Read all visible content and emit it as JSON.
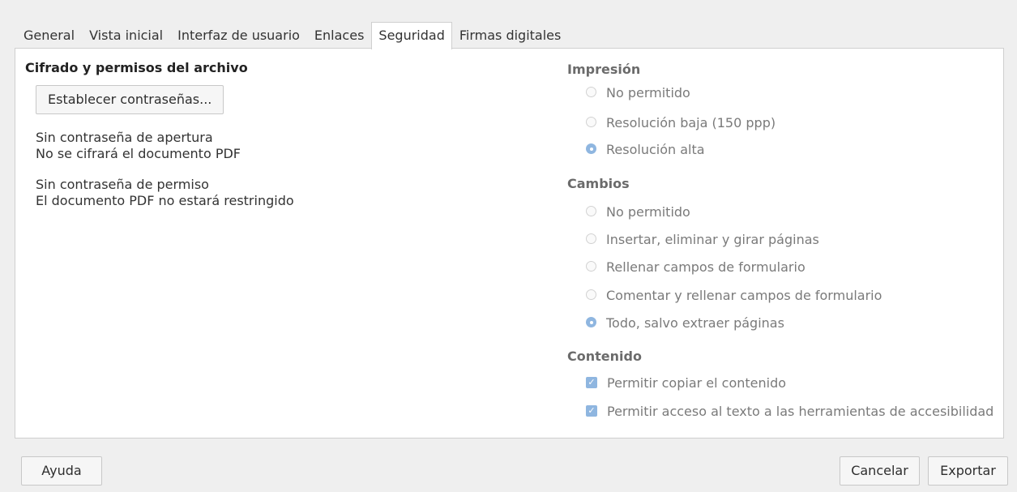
{
  "tabs": [
    {
      "label": "General",
      "active": false
    },
    {
      "label": "Vista inicial",
      "active": false
    },
    {
      "label": "Interfaz de usuario",
      "active": false
    },
    {
      "label": "Enlaces",
      "active": false
    },
    {
      "label": "Seguridad",
      "active": true
    },
    {
      "label": "Firmas digitales",
      "active": false
    }
  ],
  "left": {
    "title": "Cifrado y permisos del archivo",
    "set_passwords_button": "Establecer contraseñas...",
    "open_password_status": "Sin contraseña de apertura",
    "encryption_status": "No se cifrará el documento PDF",
    "permission_password_status": "Sin contraseña de permiso",
    "restriction_status": "El documento PDF no estará restringido"
  },
  "printing": {
    "title": "Impresión",
    "options": [
      {
        "label": "No permitido",
        "checked": false
      },
      {
        "label": "Resolución baja (150 ppp)",
        "checked": false
      },
      {
        "label": "Resolución alta",
        "checked": true
      }
    ]
  },
  "changes": {
    "title": "Cambios",
    "options": [
      {
        "label": "No permitido",
        "checked": false
      },
      {
        "label": "Insertar, eliminar y girar páginas",
        "checked": false
      },
      {
        "label": "Rellenar campos de formulario",
        "checked": false
      },
      {
        "label": "Comentar y rellenar campos de formulario",
        "checked": false
      },
      {
        "label": "Todo, salvo extraer páginas",
        "checked": true
      }
    ]
  },
  "content": {
    "title": "Contenido",
    "options": [
      {
        "label": "Permitir copiar el contenido",
        "checked": true
      },
      {
        "label": "Permitir acceso al texto a las herramientas de accesibilidad",
        "checked": true
      }
    ]
  },
  "footer": {
    "help": "Ayuda",
    "cancel": "Cancelar",
    "export": "Exportar"
  },
  "colors": {
    "accent": "#8fb6e0",
    "dialog_bg": "#efefef",
    "panel_bg": "#ffffff"
  }
}
